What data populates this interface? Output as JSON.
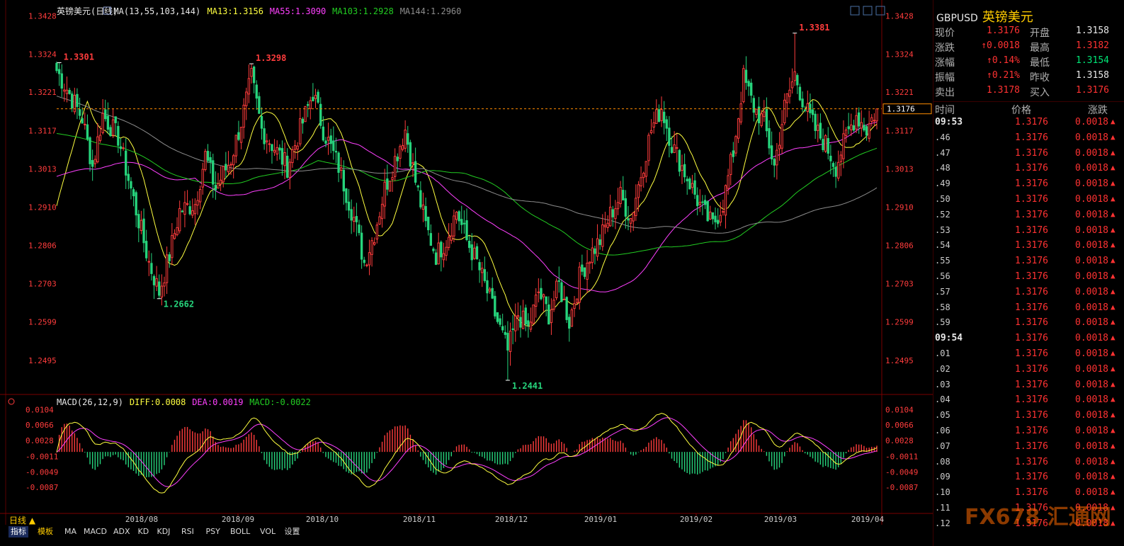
{
  "header": {
    "title": "英镑美元(日线)",
    "ma_label": "MA(13,55,103,144)",
    "ma13": "MA13:1.3156",
    "ma55": "MA55:1.3090",
    "ma103": "MA103:1.2928",
    "ma144": "MA144:1.2960"
  },
  "macd_header": {
    "label": "MACD(26,12,9)",
    "diff": "DIFF:0.0008",
    "dea": "DEA:0.0019",
    "macd": "MACD:-0.0022"
  },
  "colors": {
    "up": "#ff3c3c",
    "down": "#26d47c",
    "ma13": "#ffff40",
    "ma55": "#ff40ff",
    "ma103": "#22cc22",
    "ma144": "#8c8c8c",
    "dea": "#ff40ff",
    "diff": "#ffff40",
    "axis": "#7a0000",
    "current": "#ff8c00"
  },
  "sidebar": {
    "code": "GBPUSD",
    "name": "英镑美元",
    "quotes": [
      {
        "l1": "现价",
        "v1": "1.3176",
        "c1": "red",
        "l2": "开盘",
        "v2": "1.3158",
        "c2": "wht"
      },
      {
        "l1": "涨跌",
        "v1": "↑0.0018",
        "c1": "red",
        "l2": "最高",
        "v2": "1.3182",
        "c2": "red"
      },
      {
        "l1": "涨幅",
        "v1": "↑0.14%",
        "c1": "red",
        "l2": "最低",
        "v2": "1.3154",
        "c2": "grn"
      },
      {
        "l1": "振幅",
        "v1": "↑0.21%",
        "c1": "red",
        "l2": "昨收",
        "v2": "1.3158",
        "c2": "wht"
      },
      {
        "l1": "卖出",
        "v1": "1.3178",
        "c1": "red",
        "l2": "买入",
        "v2": "1.3176",
        "c2": "red"
      }
    ],
    "tick_headers": [
      "时间",
      "价格",
      "涨跌"
    ],
    "ticks": [
      {
        "t": "09:53",
        "bold": true
      },
      {
        "t": ".46"
      },
      {
        "t": ".47"
      },
      {
        "t": ".48"
      },
      {
        "t": ".49"
      },
      {
        "t": ".50"
      },
      {
        "t": ".52"
      },
      {
        "t": ".53"
      },
      {
        "t": ".54"
      },
      {
        "t": ".55"
      },
      {
        "t": ".56"
      },
      {
        "t": ".57"
      },
      {
        "t": ".58"
      },
      {
        "t": ".59"
      },
      {
        "t": "09:54",
        "bold": true
      },
      {
        "t": ".01"
      },
      {
        "t": ".02"
      },
      {
        "t": ".03"
      },
      {
        "t": ".04"
      },
      {
        "t": ".05"
      },
      {
        "t": ".06"
      },
      {
        "t": ".07"
      },
      {
        "t": ".08"
      },
      {
        "t": ".09"
      },
      {
        "t": ".10"
      },
      {
        "t": ".11"
      },
      {
        "t": ".12"
      }
    ],
    "tick_price": "1.3176",
    "tick_change": "0.0018"
  },
  "bottom": {
    "period": "日线 ▲",
    "buttons": [
      "指标",
      "模板",
      "MA",
      "MACD",
      "ADX",
      "KD",
      "KDJ",
      "RSI",
      "PSY",
      "BOLL",
      "VOL",
      "设置"
    ]
  },
  "watermark": "FX678 汇通网",
  "chart_data": [
    {
      "type": "candlestick",
      "title": "英镑美元(日线)",
      "y_ticks": [
        1.3428,
        1.3324,
        1.3221,
        1.3117,
        1.3013,
        1.291,
        1.2806,
        1.2703,
        1.2599,
        1.2495
      ],
      "ylim": [
        1.2441,
        1.344
      ],
      "x_labels": [
        "2018/08",
        "2018/09",
        "2018/10",
        "2018/11",
        "2018/12",
        "2019/01",
        "2019/02",
        "2019/03",
        "2019/04"
      ],
      "current_price": "1.3176",
      "annotations": [
        {
          "text": "1.3301",
          "value": 1.3301,
          "type": "high"
        },
        {
          "text": "1.2662",
          "value": 1.2662,
          "type": "low"
        },
        {
          "text": "1.3298",
          "value": 1.3298,
          "type": "high"
        },
        {
          "text": "1.2441",
          "value": 1.2441,
          "type": "low"
        },
        {
          "text": "1.3381",
          "value": 1.3381,
          "type": "high"
        }
      ],
      "ma_values_last": {
        "MA13": 1.3156,
        "MA55": 1.309,
        "MA103": 1.2928,
        "MA144": 1.296
      }
    },
    {
      "type": "macd",
      "title": "MACD(26,12,9)",
      "y_ticks": [
        0.0104,
        0.0066,
        0.0028,
        -0.0011,
        -0.0049,
        -0.0087
      ],
      "ylim": [
        -0.0125,
        0.0115
      ],
      "last": {
        "DIFF": 0.0008,
        "DEA": 0.0019,
        "MACD": -0.0022
      }
    }
  ]
}
